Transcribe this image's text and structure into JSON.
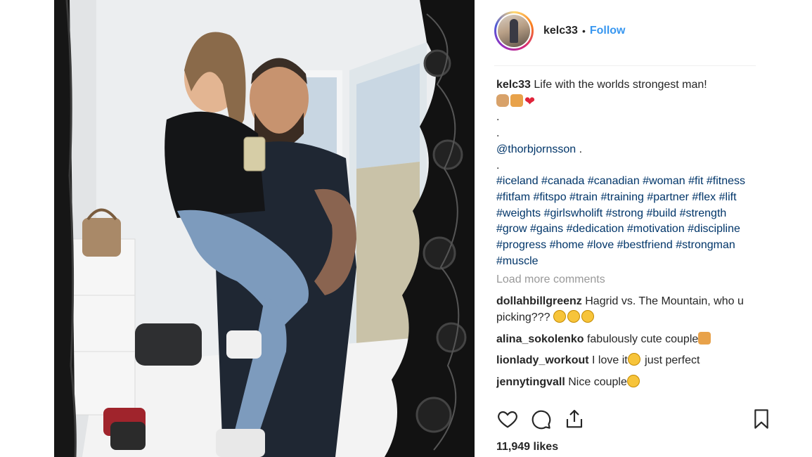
{
  "post": {
    "username": "kelc33",
    "separator": "•",
    "follow_label": "Follow",
    "caption": {
      "username": "kelc33",
      "text": "Life with the worlds strongest man!",
      "dot1": ".",
      "dot2": ".",
      "mention": "@thorbjornsson",
      "mention_suffix": " .",
      "dot3": ".",
      "hashtags": "#iceland #canada #canadian #woman #fit #fitness #fitfam #fitspo #train #training #partner #flex #lift #weights #girlswholift #strong #build #strength #grow #gains #dedication #motivation #discipline #progress #home #love #bestfriend #strongman #muscle"
    },
    "load_more_label": "Load more comments",
    "comments": [
      {
        "username": "dollahbillgreenz",
        "text": "Hagrid vs. The Mountain, who u picking???"
      },
      {
        "username": "alina_sokolenko",
        "text": "fabulously cute couple"
      },
      {
        "username": "lionlady_workout",
        "text": "I love it",
        "text2": " just perfect"
      },
      {
        "username": "jennytingvall",
        "text": "Nice couple"
      }
    ],
    "likes": "11,949 likes"
  },
  "icons": [
    "heart-icon",
    "comment-icon",
    "share-icon",
    "bookmark-icon"
  ],
  "colors": {
    "link": "#3897f0",
    "hashtag": "#003569",
    "muted": "#999999",
    "text": "#262626"
  }
}
